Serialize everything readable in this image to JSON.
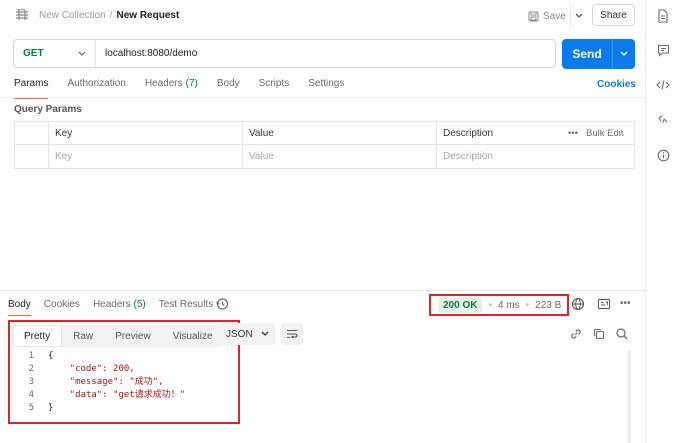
{
  "header": {
    "collection": "New Collection",
    "separator": "/",
    "request_name": "New Request",
    "save_label": "Save",
    "share_label": "Share"
  },
  "request": {
    "method": "GET",
    "url": "localhost:8080/demo",
    "send_label": "Send"
  },
  "request_tabs": [
    {
      "label": "Params",
      "count": ""
    },
    {
      "label": "Authorization",
      "count": ""
    },
    {
      "label": "Headers",
      "count": "(7)"
    },
    {
      "label": "Body",
      "count": ""
    },
    {
      "label": "Scripts",
      "count": ""
    },
    {
      "label": "Settings",
      "count": ""
    }
  ],
  "cookies_label": "Cookies",
  "query_params": {
    "title": "Query Params",
    "columns": [
      "Key",
      "Value",
      "Description"
    ],
    "bulk_edit": "Bulk Edit",
    "more": "•••",
    "placeholders": [
      "Key",
      "Value",
      "Description"
    ]
  },
  "response": {
    "tabs": [
      {
        "label": "Body",
        "count": ""
      },
      {
        "label": "Cookies",
        "count": ""
      },
      {
        "label": "Headers",
        "count": "(5)"
      },
      {
        "label": "Test Results",
        "count": ""
      }
    ],
    "status": "200 OK",
    "time": "4 ms",
    "size": "223 B",
    "more": "•••",
    "view_tabs": [
      "Pretty",
      "Raw",
      "Preview",
      "Visualize"
    ],
    "format": "JSON",
    "body_lines": [
      {
        "no": "1",
        "text": "{"
      },
      {
        "no": "2",
        "text": "    \"code\": 200,"
      },
      {
        "no": "3",
        "text": "    \"message\": \"成功\","
      },
      {
        "no": "4",
        "text": "    \"data\": \"get请求成功！\""
      },
      {
        "no": "5",
        "text": "}"
      }
    ]
  },
  "colors": {
    "accent": "#097bed",
    "method": "#0b7a3e",
    "tab_active": "#ff6c37",
    "highlight_box": "#e0252a"
  }
}
